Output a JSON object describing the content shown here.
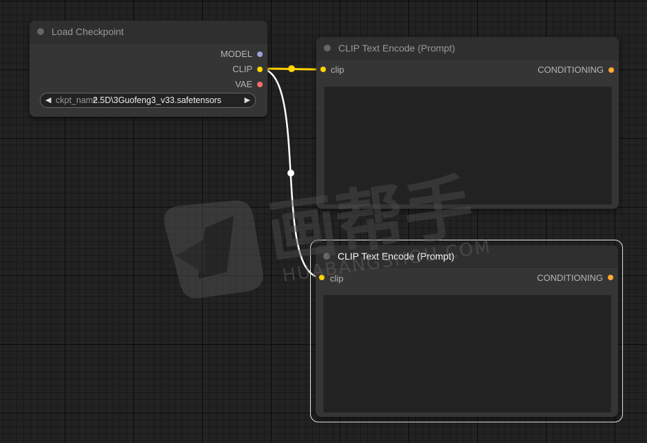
{
  "nodes": {
    "checkpoint": {
      "title": "Load Checkpoint",
      "outputs": [
        {
          "label": "MODEL",
          "color": "#a1a1e0"
        },
        {
          "label": "CLIP",
          "color": "#ffd500"
        },
        {
          "label": "VAE",
          "color": "#ff6e6e"
        }
      ],
      "widget": {
        "name": "ckpt_name",
        "value": "2.5D\\3Guofeng3_v33.safetensors"
      }
    },
    "clip_encode_1": {
      "title": "CLIP Text Encode (Prompt)",
      "input": {
        "label": "clip",
        "color": "#ffd500"
      },
      "output": {
        "label": "CONDITIONING",
        "color": "#ffa931"
      },
      "text": ""
    },
    "clip_encode_2": {
      "title": "CLIP Text Encode (Prompt)",
      "input": {
        "label": "clip",
        "color": "#ffd500"
      },
      "output": {
        "label": "CONDITIONING",
        "color": "#ffa931"
      },
      "text": ""
    }
  },
  "links": {
    "clip_to_encode_1_color": "#ffd500",
    "clip_to_encode_2_color": "#ffffff"
  },
  "watermark": {
    "text": "画帮手",
    "subtext": "HUABANGSHOU.COM"
  }
}
